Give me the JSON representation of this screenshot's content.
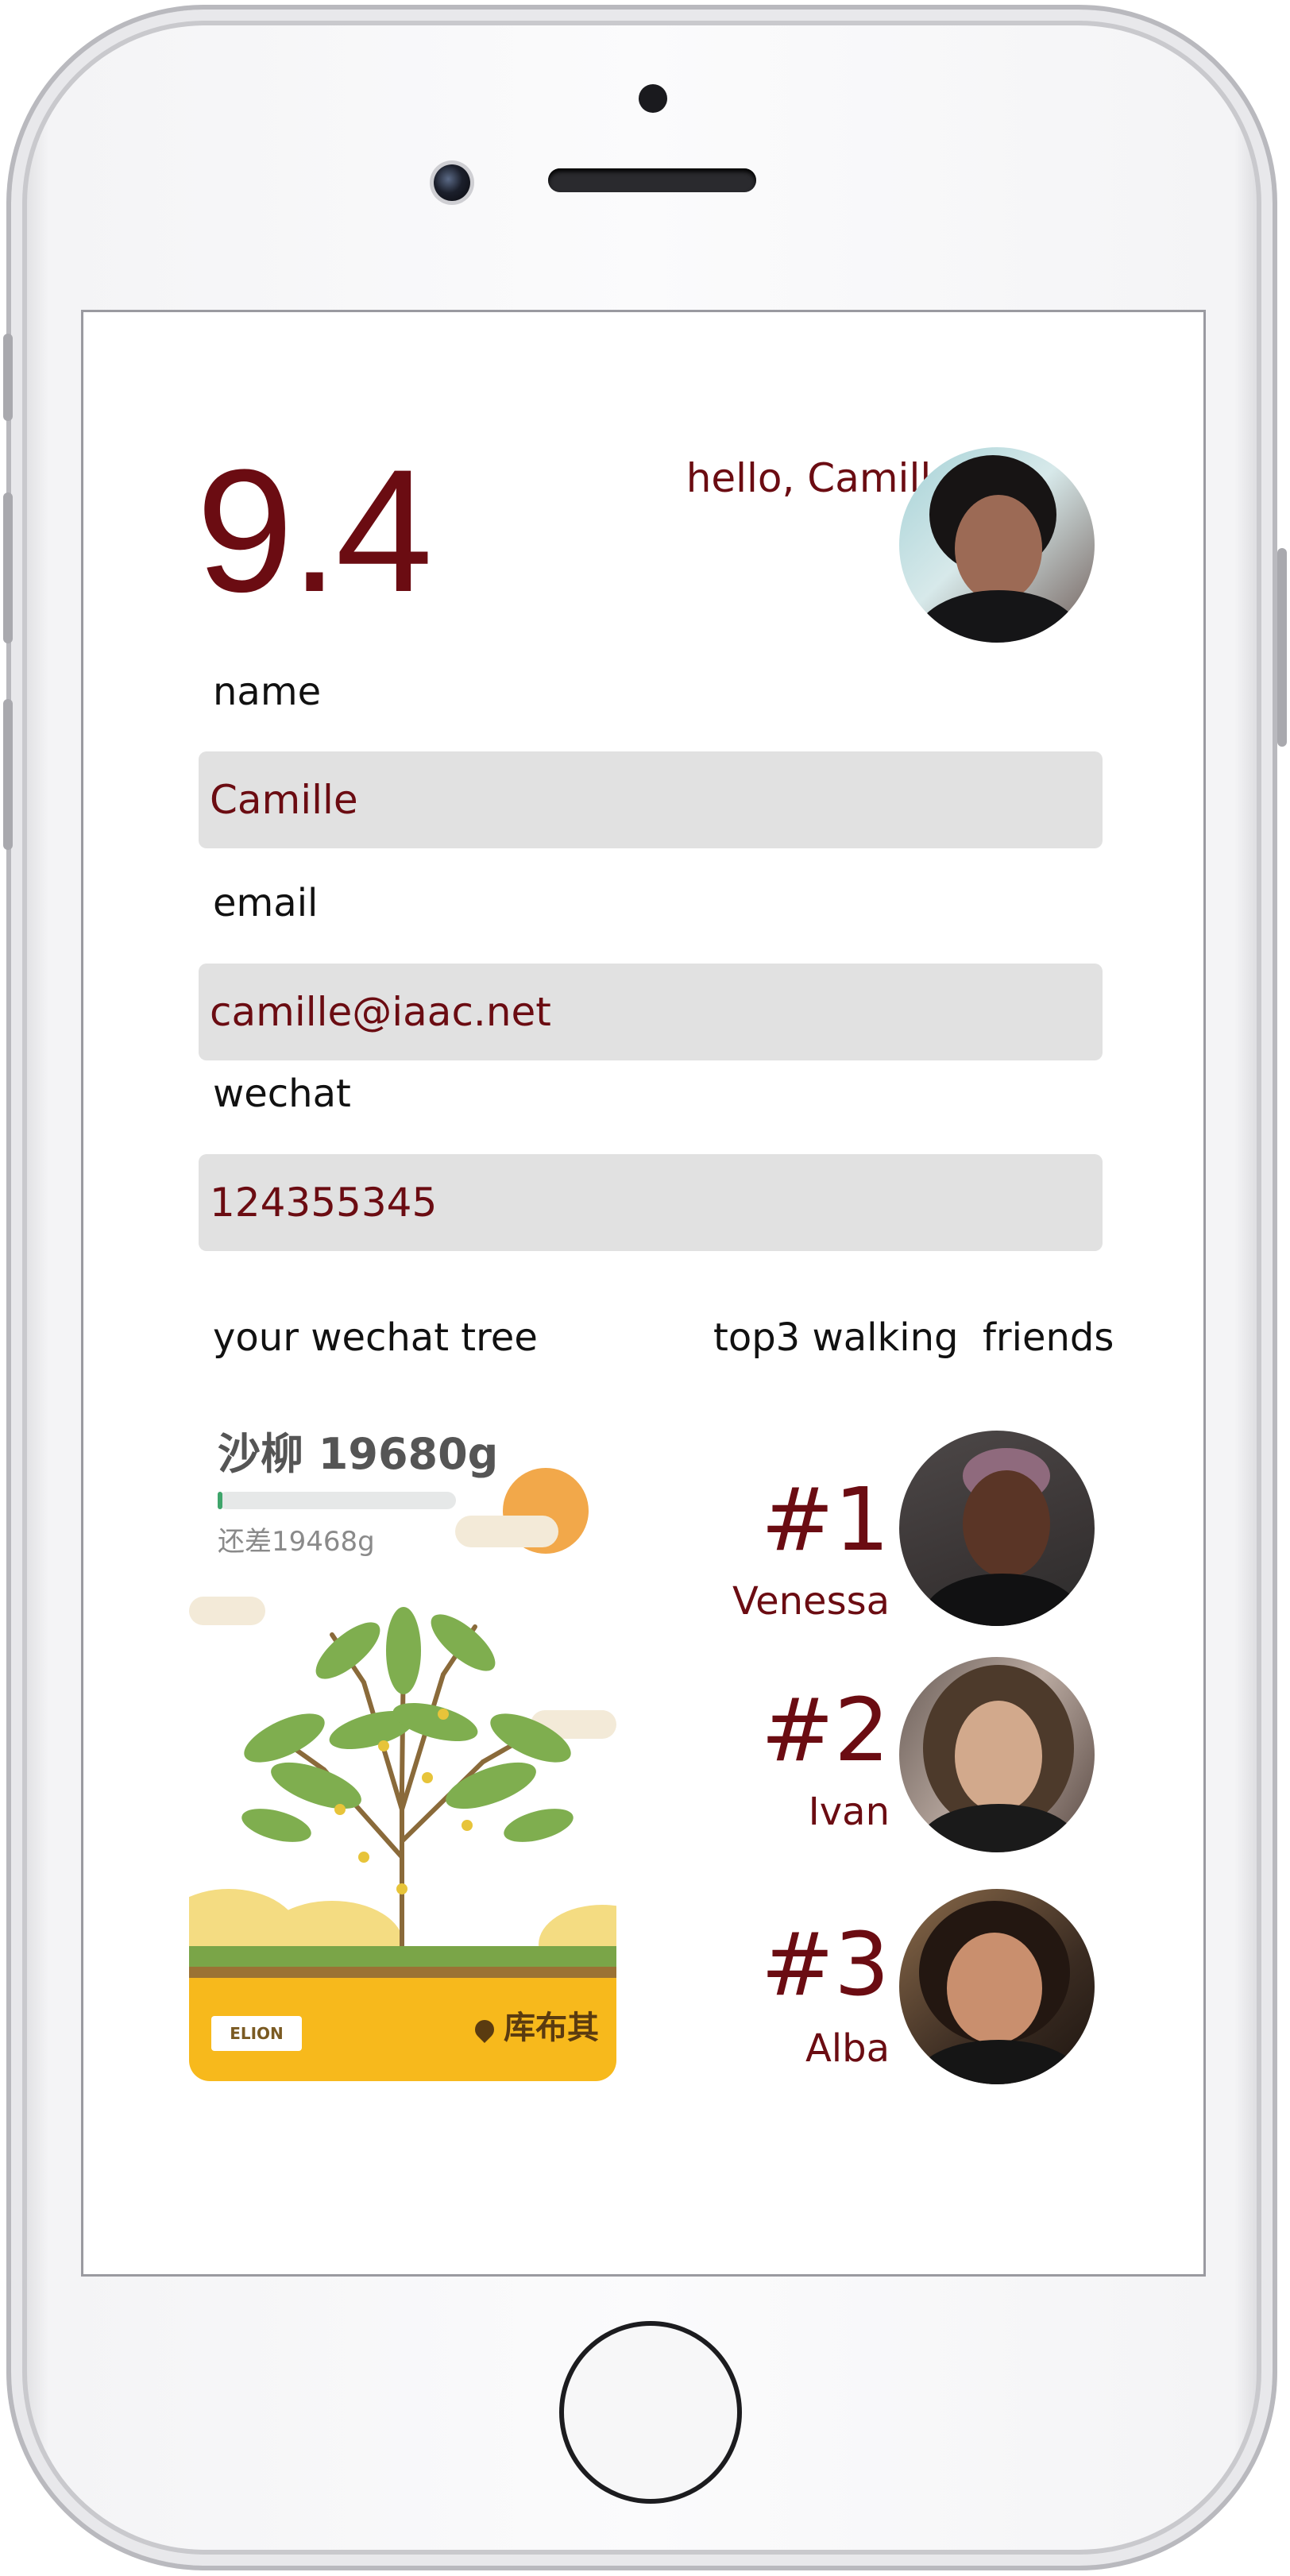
{
  "profile": {
    "score": "9.4",
    "greeting": "hello, Camille"
  },
  "form": {
    "name": {
      "label": "name",
      "value": "Camille"
    },
    "email": {
      "label": "email",
      "value": "camille@iaac.net"
    },
    "wechat": {
      "label": "wechat",
      "value": "124355345"
    }
  },
  "tree": {
    "section_title": "your wechat tree",
    "name_weight": "沙柳 19680g",
    "remaining": "还差19468g",
    "progress": 0.02,
    "brand": "ELION",
    "location": "库布其"
  },
  "friends": {
    "section_title": "top3 walking  friends",
    "items": [
      {
        "rank": "#1",
        "name": "Venessa"
      },
      {
        "rank": "#2",
        "name": "Ivan"
      },
      {
        "rank": "#3",
        "name": "Alba"
      }
    ]
  },
  "colors": {
    "accent": "#6b0c12",
    "field_bg": "#e1e1e1",
    "tree_ground": "#f7b91c",
    "sun": "#f2a84a"
  }
}
